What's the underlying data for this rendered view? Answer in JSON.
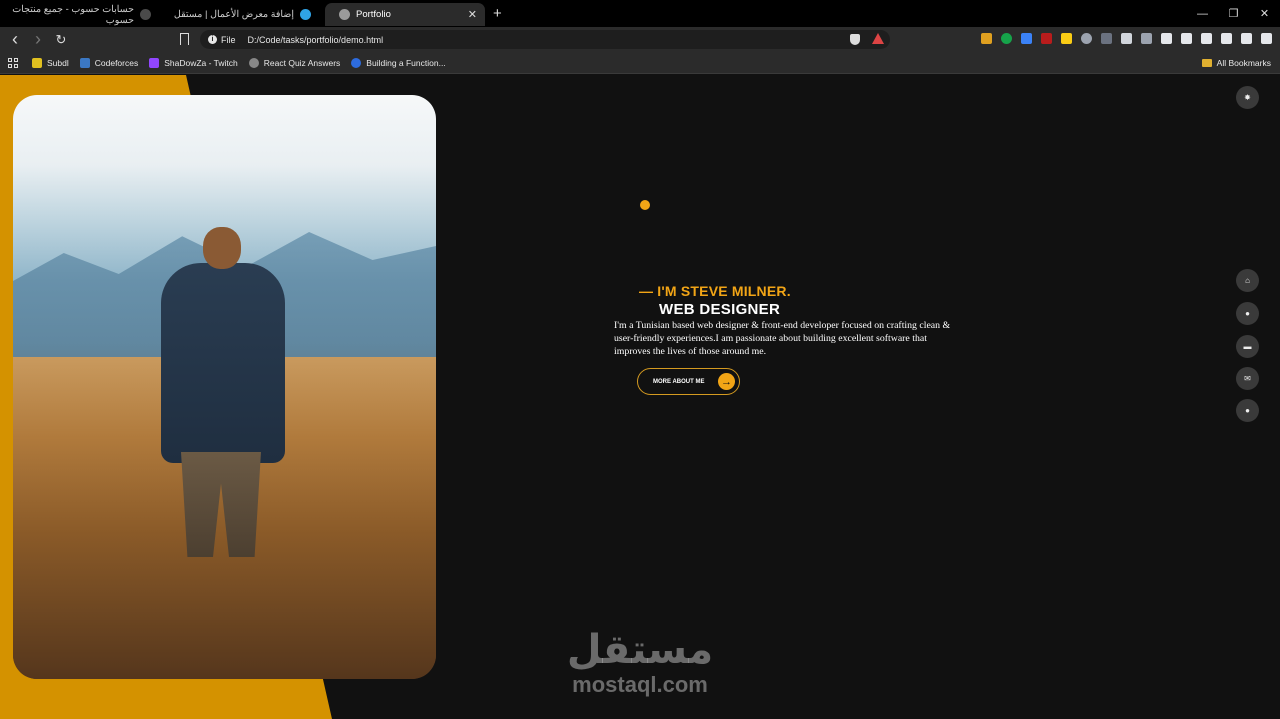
{
  "browser": {
    "tabs": [
      {
        "title": "حسابات حسوب - جميع منتجات حسوب",
        "favicon_color": "#4a4a4a"
      },
      {
        "title": "إضافة معرض الأعمال | مستقل",
        "favicon_color": "#2fa3e6"
      },
      {
        "title": "Portfolio",
        "favicon_color": "#9a9a9a",
        "active": true
      }
    ],
    "new_tab": "+",
    "window_controls": {
      "minimize": "—",
      "restore": "❐",
      "close": "✕"
    },
    "nav": {
      "back": "‹",
      "forward": "›",
      "reload": "↻"
    },
    "address": {
      "scheme_label": "File",
      "url": "D:/Code/tasks/portfolio/demo.html"
    },
    "bookmarks": [
      {
        "label": "Subdl",
        "color": "#e0c020"
      },
      {
        "label": "Codeforces",
        "color": "#3b78c4"
      },
      {
        "label": "ShaDowZa - Twitch",
        "color": "#9146ff"
      },
      {
        "label": "React Quiz Answers",
        "color": "#888888"
      },
      {
        "label": "Building a Function...",
        "color": "#2d6cdf"
      }
    ],
    "all_bookmarks": "All Bookmarks"
  },
  "hero": {
    "intro": "— I'M STEVE MILNER.",
    "role": "WEB DESIGNER",
    "bio": "I'm a Tunisian based web designer & front-end developer focused on crafting clean & user-friendly experiences.I am passionate about building excellent software that improves the lives of those around me.",
    "cta_label": "MORE ABOUT ME",
    "cta_icon": "→",
    "accent_color": "#f2a516"
  },
  "side_nav": [
    {
      "name": "home",
      "icon": "⌂"
    },
    {
      "name": "about",
      "icon": "●"
    },
    {
      "name": "portfolio",
      "icon": "▬"
    },
    {
      "name": "contact",
      "icon": "✉"
    },
    {
      "name": "blog",
      "icon": "●"
    }
  ],
  "theme_toggle_icon": "✸",
  "watermark": {
    "arabic": "مستقل",
    "latin": "mostaql.com"
  }
}
